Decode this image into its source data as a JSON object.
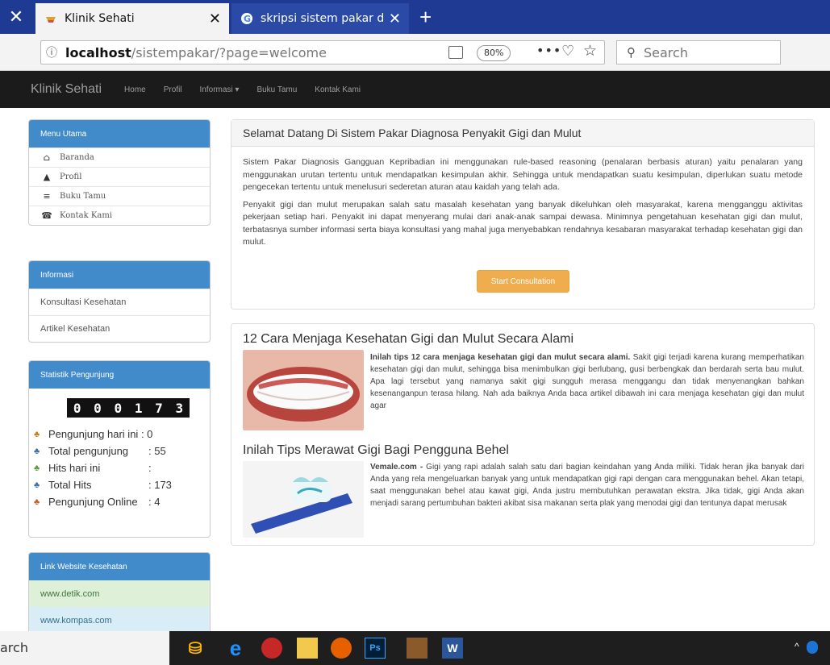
{
  "browser": {
    "close_glyph": "✕",
    "tabs": [
      {
        "title": "Klinik Sehati",
        "close": "✕"
      },
      {
        "title": "skripsi sistem pakar diagnosa p",
        "close": "✕"
      }
    ],
    "newtab_glyph": "+",
    "url_host": "localhost",
    "url_path": "/sistempakar/?page=welcome",
    "zoom": "80%",
    "search_placeholder": "Search"
  },
  "site": {
    "brand": "Klinik Sehati",
    "nav": [
      "Home",
      "Profil",
      "Informasi ▾",
      "Buku Tamu",
      "Kontak Kami"
    ]
  },
  "sidebar": {
    "menu_title": "Menu Utama",
    "menu_items": [
      {
        "icon": "home-icon",
        "label": "Baranda"
      },
      {
        "icon": "user-icon",
        "label": "Profil"
      },
      {
        "icon": "list-icon",
        "label": "Buku Tamu"
      },
      {
        "icon": "contact-icon",
        "label": "Kontak Kami"
      }
    ],
    "info_title": "Informasi",
    "info_items": [
      "Konsultasi Kesehatan",
      "Artikel Kesehatan"
    ],
    "stats_title": "Statistik Pengunjung",
    "counter_digits": [
      "0",
      "0",
      "0",
      "1",
      "7",
      "3"
    ],
    "stats": [
      {
        "label": "Pengunjung hari ini",
        "value": ": 0"
      },
      {
        "label": "Total pengunjung",
        "value": ": 55"
      },
      {
        "label": "Hits hari ini",
        "value": ":"
      },
      {
        "label": "Total Hits",
        "value": ": 173"
      },
      {
        "label": "Pengunjung Online",
        "value": ": 4"
      }
    ],
    "links_title": "Link Website Kesehatan",
    "links": [
      "www.detik.com",
      "www.kompas.com"
    ]
  },
  "main": {
    "welcome_title": "Selamat Datang Di Sistem Pakar Diagnosa Penyakit Gigi dan Mulut",
    "para1": "Sistem Pakar Diagnosis Gangguan Kepribadian ini menggunakan rule-based reasoning (penalaran berbasis aturan) yaitu penalaran yang menggunakan urutan tertentu untuk mendapatkan kesimpulan akhir. Sehingga untuk mendapatkan suatu kesimpulan, diperlukan suatu metode pengecekan tertentu untuk menelusuri sederetan aturan atau kaidah yang telah ada.",
    "para2": "Penyakit gigi dan mulut merupakan salah satu masalah kesehatan yang banyak dikeluhkan oleh masyarakat, karena mengganggu aktivitas pekerjaan setiap hari. Penyakit ini dapat menyerang mulai dari anak-anak sampai dewasa. Minimnya pengetahuan kesehatan gigi dan mulut, terbatasnya sumber informasi serta biaya konsultasi yang mahal juga menyebabkan rendahnya kesabaran masyarakat terhadap kesehatan gigi dan mulut.",
    "start_button": "Start Consultation",
    "articles": [
      {
        "title": "12 Cara Menjaga Kesehatan Gigi dan Mulut Secara Alami",
        "lead": "Inilah tips 12 cara menjaga kesehatan gigi dan mulut secara alami.",
        "text": " Sakit gigi terjadi karena kurang memperhatikan kesehatan gigi dan mulut, sehingga bisa menimbulkan gigi berlubang, gusi berbengkak dan berdarah serta bau mulut. Apa lagi tersebut yang namanya sakit gigi sungguh merasa menggangu dan tidak menyenangkan bahkan kesenanganpun terasa hilang. Nah ada baiknya Anda baca artikel dibawah ini cara menjaga kesehatan gigi dan mulut agar"
      },
      {
        "title": "Inilah Tips Merawat Gigi Bagi Pengguna Behel",
        "lead": "Vemale.com -",
        "text": " Gigi yang rapi adalah salah satu dari bagian keindahan yang Anda miliki. Tidak heran jika banyak dari Anda yang rela mengeluarkan banyak yang untuk mendapatkan gigi rapi dengan cara menggunakan behel. Akan tetapi, saat menggunakan behel atau kawat gigi, Anda justru membutuhkan perawatan ekstra. Jika tidak, gigi Anda akan menjadi sarang pertumbuhan bakteri akibat sisa makanan serta plak yang menodai gigi dan tentunya dapat merusak"
      }
    ]
  },
  "taskbar": {
    "search_text": "arch",
    "apps": [
      "Ps",
      "W"
    ]
  }
}
